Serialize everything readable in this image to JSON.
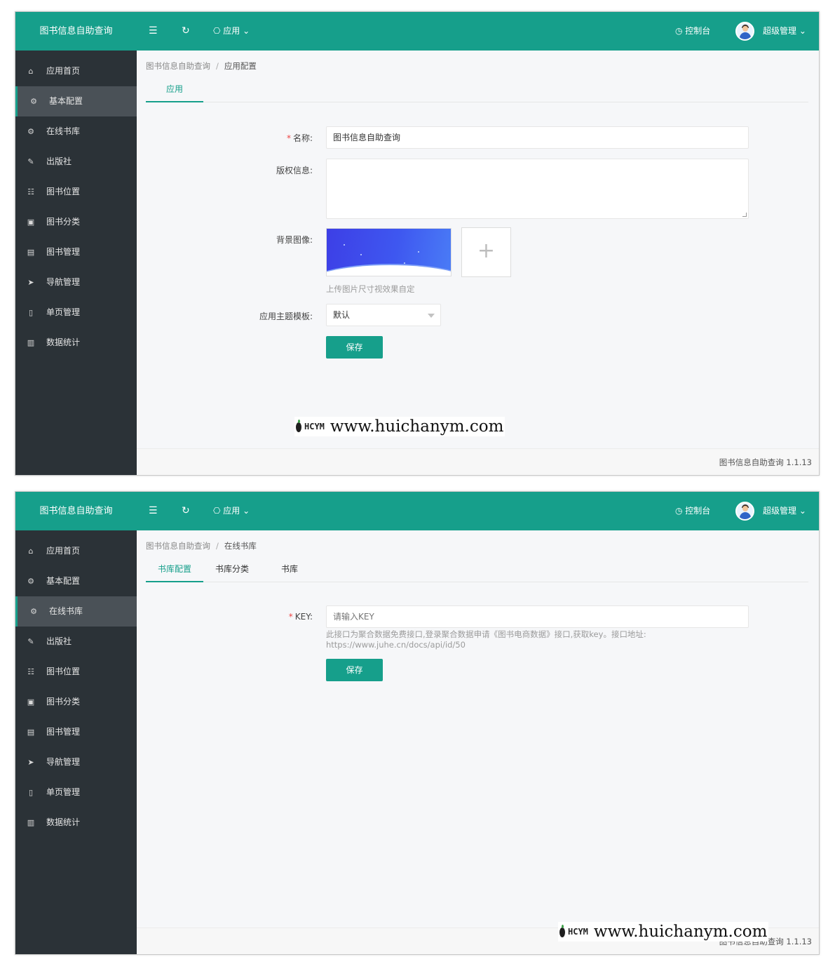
{
  "brand": "图书信息自助查询",
  "topbar": {
    "menu_icon": "☰",
    "refresh_icon": "↻",
    "app_label": "⎔ 应用 ⌄",
    "console_label": "◷ 控制台",
    "user_label": "超级管理 ⌄"
  },
  "sidebar": [
    {
      "icon": "home-icon",
      "glyph": "⌂",
      "label": "应用首页"
    },
    {
      "icon": "gear-icon",
      "glyph": "⚙",
      "label": "基本配置"
    },
    {
      "icon": "gear-icon",
      "glyph": "⚙",
      "label": "在线书库"
    },
    {
      "icon": "edit-icon",
      "glyph": "✎",
      "label": "出版社"
    },
    {
      "icon": "grid-icon",
      "glyph": "☷",
      "label": "图书位置"
    },
    {
      "icon": "save-icon",
      "glyph": "▣",
      "label": "图书分类"
    },
    {
      "icon": "book-icon",
      "glyph": "▤",
      "label": "图书管理"
    },
    {
      "icon": "send-icon",
      "glyph": "➤",
      "label": "导航管理"
    },
    {
      "icon": "file-icon",
      "glyph": "▯",
      "label": "单页管理"
    },
    {
      "icon": "chart-icon",
      "glyph": "▥",
      "label": "数据统计"
    }
  ],
  "screen1": {
    "breadcrumb": {
      "root": "图书信息自助查询",
      "sep": "/",
      "current": "应用配置"
    },
    "tabs": [
      "应用"
    ],
    "form": {
      "name_label": "名称:",
      "name_value": "图书信息自助查询",
      "copyright_label": "版权信息:",
      "copyright_value": "",
      "bg_label": "背景图像:",
      "upload_plus": "+",
      "upload_hint": "上传图片尺寸视效果自定",
      "theme_label": "应用主题模板:",
      "theme_value": "默认",
      "save_label": "保存"
    },
    "footer": "图书信息自助查询 1.1.13"
  },
  "screen2": {
    "breadcrumb": {
      "root": "图书信息自助查询",
      "sep": "/",
      "current": "在线书库"
    },
    "tabs": [
      "书库配置",
      "书库分类",
      "书库"
    ],
    "form": {
      "key_label": "KEY:",
      "key_placeholder": "请输入KEY",
      "hint_line1": "此接口为聚合数据免费接口,登录聚合数据申请《图书电商数据》接口,获取key。接口地址:",
      "hint_line2": "https://www.juhe.cn/docs/api/id/50",
      "save_label": "保存"
    },
    "footer": "图书信息自助查询 1.1.13"
  },
  "watermark": {
    "logo": "HCYM",
    "url": "www.huichanym.com"
  },
  "colors": {
    "primary": "#169f8b",
    "sidebar": "#2b3237",
    "sidebar_active": "#4a5157"
  }
}
